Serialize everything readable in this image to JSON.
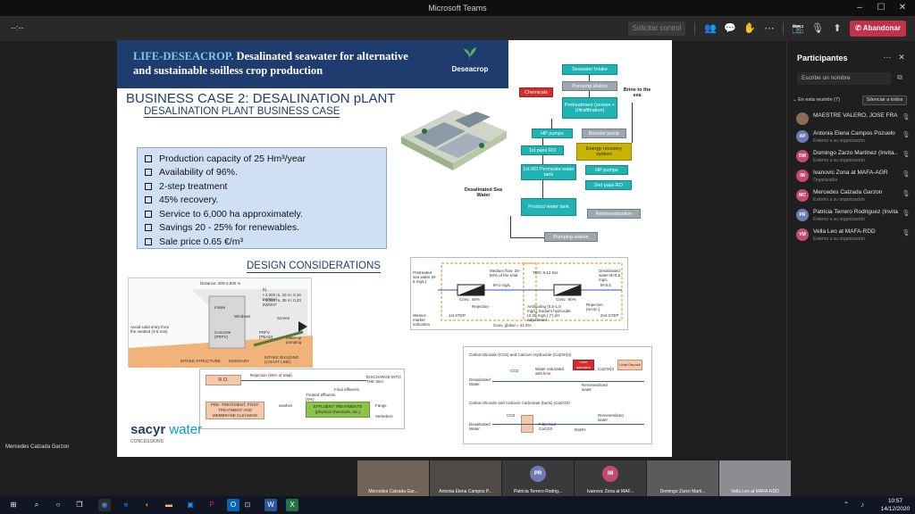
{
  "window": {
    "title": "Microsoft Teams"
  },
  "toolbar": {
    "timer": "--:--",
    "request_control": "Solicitar control",
    "leave": "Abandonar"
  },
  "stage": {
    "presenter_name": "Mercedes Calzada Garzon"
  },
  "slide": {
    "header_brand": "LIFE-DESEACROP.",
    "header_text_1": " Desalinated seawater for alternative",
    "header_text_2": "and sustainable soilless crop production",
    "logo_name": "Deseacrop",
    "bc_title": "BUSINESS CASE 2: DESALINATION pLANT",
    "bc_subtitle": "DESALINATION PLANT BUSINESS CASE",
    "bullets": [
      "Production capacity of 25 Hm³/year",
      "Availability of 96%.",
      "2-step treatment",
      "45% recovery.",
      "Service to 6,000 ha approximately.",
      "Savings 20 - 25% for renewables.",
      "Sale price 0.65 €/m³"
    ],
    "design_title": "DESIGN CONSIDERATIONS",
    "flow": {
      "seawater_intake": "Seawater Intake",
      "pumping_station_1": "Pumping station",
      "chemicals": "Chemicals",
      "pretreatment": "Pretreatment (screen + Ultrafiltration)",
      "brine": "Brine to the sea",
      "hp_pumps_1": "HP pumps",
      "booster_pump": "Booster pump",
      "first_pass": "1st pass RO",
      "energy_recovery": "Energy recovery system",
      "permeate_tank": "1st RO Permeate water tank",
      "hp_pumps_2": "HP pumps",
      "second_pass": "2nd pass RO",
      "desalinated": "Desalinated Sea Water",
      "product_tank": "Product water tank",
      "remineralization": "Remineralization",
      "pumping_station_2": "Pumping station"
    },
    "intake": {
      "distance": "Distance: 500-1,500 m",
      "intake": "Intake",
      "windows": "Windows",
      "concrete": "Concrete (PRFV)",
      "prfv": "PRFV (PEAD)",
      "screen": "Screen",
      "avoid": "Avoid solid entry from the seabed (3-5 mts)",
      "makeup": "Make-up pumping",
      "intake_structure": "INTAKE STRUCTURE",
      "emissary": "EMISSARY",
      "intake_building": "INTAKE BUILDING (COAST LINE)",
      "ej": "Ej.",
      "ej1": "• 2.000 m, 15 m: 0,16 kWh/m³",
      "ej2": "• 3.000 m, 35 m: 0,33 kWh/m³"
    },
    "process2": {
      "pretreated": "Pretreated sea water (8-5 mg/L)",
      "medium_flow": "Medium flow: 25-60% of the total",
      "tds": "TDS: 9-12 bar",
      "desalinated_out": "Desalinated water B<0,5 mg/L",
      "conv1": "Conv.: 45%",
      "conv2": "Conv.: 90%",
      "rejection1": "Rejection",
      "rejection2": "Rejection (recirc.)",
      "step1": "1st STEP",
      "step2": "2nd STEP",
      "global": "Conv. global = 41,5%",
      "additions": "Antifouling (0,5-1,0 mg/L) Sodium hydroxide (2-20 mg/L) (*) pH adjustment",
      "welnez": "Welnez marker indication",
      "bmg1": "B<1 mg/L",
      "bmg2": "B<0,5"
    },
    "chem": {
      "title1": "Carbon Dioxide (CO2) and Calcium Hydroxide (Ca(OH)2)",
      "title2": "Carbon Dioxide and Calcium Carbonate (beds) (CaCO3)",
      "desal_water_1": "Desalinated Water",
      "desal_water_2": "Desalinated Water",
      "co2_1": "CO2",
      "co2_2": "CO2",
      "sat_lime": "Water saturated with lime",
      "lime_saturator": "Lime saturator",
      "caoh2": "Ca(OH)2",
      "lime_deposit": "Lime Deposit",
      "remin1": "Remineralized water",
      "remin2": "Remineralized water",
      "filter_bed": "Filter bed CaCO3",
      "naoh": "NaOH"
    },
    "roflow": {
      "ro": "R.O.",
      "rejection": "Rejection (55% of total)",
      "discharge": "DISCHARGE INTO THE SEA",
      "final_effluents": "Final effluents",
      "treated": "Treated effluents (5%)",
      "pretreat": "PRE- TREATMENT, POST- TREATMENT AND MEMBRANE CLEANING",
      "washes": "washes",
      "effluent": "EFFLUENT TREATMENTS (physical chemicals, etc.)",
      "fangs": "Fangs",
      "landfill": "Vertedero"
    },
    "sacyr": "sacyr",
    "sacyr_water": " water",
    "concessions": "CONCESSIONS"
  },
  "panel": {
    "title": "Participantes",
    "search_placeholder": "Escribe un nombre",
    "in_meeting": "En esta reunión (7)",
    "mute_all": "Silenciar a todos",
    "participants": [
      {
        "initials": "",
        "name": "MAESTRE VALERO, JOSÉ FRANCI...",
        "sub": "",
        "color": "#8a6b5a"
      },
      {
        "initials": "AP",
        "name": "Antonia Elena Campos Pozuelo",
        "sub": "Externo a su organización",
        "color": "#6b7bb3"
      },
      {
        "initials": "DM",
        "name": "Domingo Zarzo Martinez (Invita...",
        "sub": "Externo a su organización",
        "color": "#c44b6b"
      },
      {
        "initials": "IM",
        "name": "Ivanovic Zona at MAFA-AGR",
        "sub": "Organizador",
        "color": "#c44b6b"
      },
      {
        "initials": "MC",
        "name": "Mercedes Calzada Garzon",
        "sub": "Externo a su organización",
        "color": "#c44b6b"
      },
      {
        "initials": "PR",
        "name": "Patricia Terrero Rodriguez (Invita...",
        "sub": "Externo a su organización",
        "color": "#6b7bb3"
      },
      {
        "initials": "VM",
        "name": "Vella Leo at MAFA-RDD",
        "sub": "Externo a su organización",
        "color": "#c44b6b"
      }
    ]
  },
  "videos": [
    {
      "caption": "Mercedes Calzada Gar...",
      "initials": "",
      "bg": "#6f6455"
    },
    {
      "caption": "Antonia Elena Campos P...",
      "initials": "",
      "bg": "#4d4a48"
    },
    {
      "caption": "Patricia Terrero Rodrig...",
      "initials": "PR",
      "bg": "#3a3a3a",
      "icolor": "#6b7bb3"
    },
    {
      "caption": "Ivanovic Zona at MAF...",
      "initials": "IM",
      "bg": "#3a3a3a",
      "icolor": "#c44b6b"
    },
    {
      "caption": "Domingo Zarzo Marti...",
      "initials": "",
      "bg": "#5b5a5c"
    },
    {
      "caption": "Vella Leo at MAFA-RDD",
      "initials": "",
      "bg": "#8c8c92"
    }
  ],
  "taskbar": {
    "time": "10:57",
    "date": "14/12/2020"
  }
}
